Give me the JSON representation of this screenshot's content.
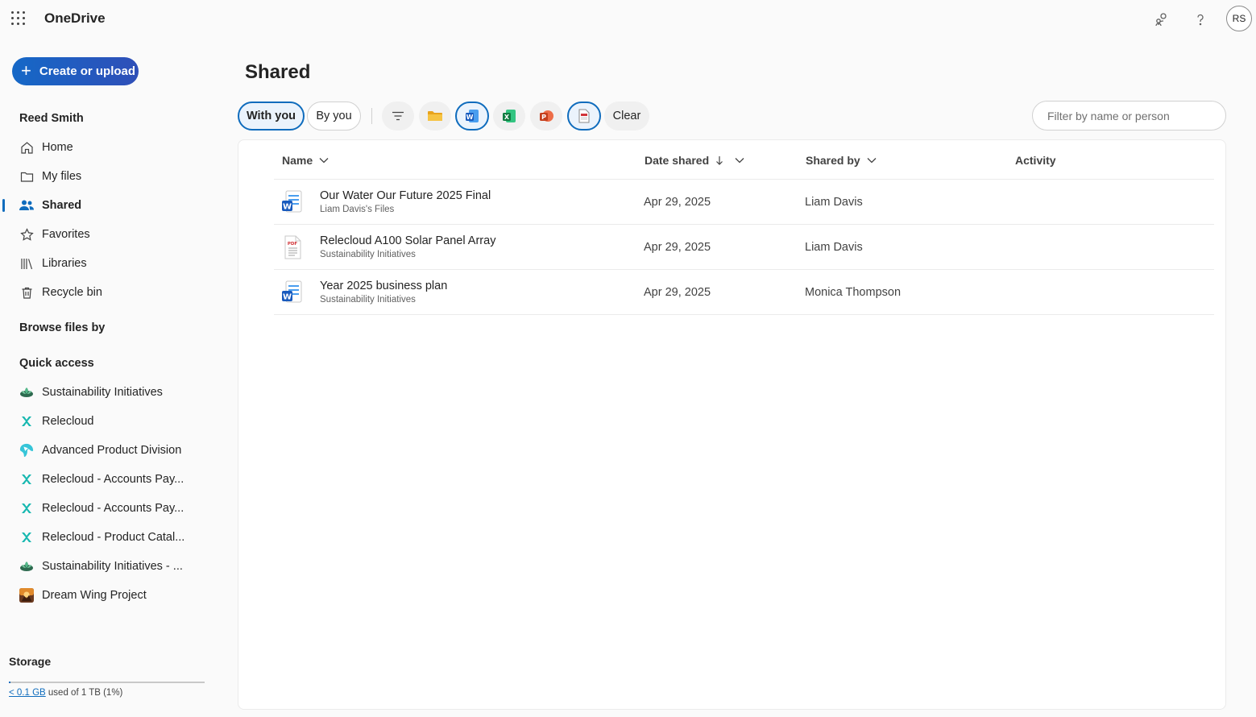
{
  "app": {
    "name": "OneDrive",
    "user_initials": "RS"
  },
  "sidebar": {
    "create_label": "Create or upload",
    "user_name": "Reed Smith",
    "nav": [
      {
        "label": "Home",
        "icon": "home-icon"
      },
      {
        "label": "My files",
        "icon": "folder-icon"
      },
      {
        "label": "Shared",
        "icon": "people-icon",
        "active": true
      },
      {
        "label": "Favorites",
        "icon": "star-icon"
      },
      {
        "label": "Libraries",
        "icon": "library-icon"
      },
      {
        "label": "Recycle bin",
        "icon": "trash-icon"
      }
    ],
    "browse_title": "Browse files by",
    "quick_access_title": "Quick access",
    "quick_access": [
      {
        "label": "Sustainability Initiatives",
        "icon": "sustainability-site-icon"
      },
      {
        "label": "Relecloud",
        "icon": "relecloud-site-icon"
      },
      {
        "label": "Advanced Product Division",
        "icon": "product-division-site-icon"
      },
      {
        "label": "Relecloud - Accounts Pay...",
        "icon": "relecloud-site-icon"
      },
      {
        "label": "Relecloud - Accounts Pay...",
        "icon": "relecloud-site-icon"
      },
      {
        "label": "Relecloud - Product Catal...",
        "icon": "relecloud-site-icon"
      },
      {
        "label": "Sustainability Initiatives - ...",
        "icon": "sustainability-site-icon"
      },
      {
        "label": "Dream Wing Project",
        "icon": "dream-wing-site-icon"
      }
    ],
    "storage": {
      "title": "Storage",
      "used_link": "< 0.1 GB",
      "used_text": " used of 1 TB (1%)",
      "percent_used": 1
    }
  },
  "main": {
    "title": "Shared",
    "tabs": [
      {
        "label": "With you",
        "selected": true
      },
      {
        "label": "By you",
        "selected": false
      }
    ],
    "filters": [
      "filter-icon",
      "folder-type-icon",
      "word-type-icon",
      "excel-type-icon",
      "powerpoint-type-icon",
      "pdf-type-icon"
    ],
    "clear_label": "Clear",
    "search_placeholder": "Filter by name or person",
    "columns": {
      "name": "Name",
      "date": "Date shared",
      "shared_by": "Shared by",
      "activity": "Activity"
    },
    "rows": [
      {
        "name": "Our Water Our Future 2025 Final",
        "location": "Liam Davis's Files",
        "date": "Apr 29, 2025",
        "shared_by": "Liam Davis",
        "type": "word"
      },
      {
        "name": "Relecloud A100 Solar Panel Array",
        "location": "Sustainability Initiatives",
        "date": "Apr 29, 2025",
        "shared_by": "Liam Davis",
        "type": "pdf"
      },
      {
        "name": "Year 2025 business plan",
        "location": "Sustainability Initiatives",
        "date": "Apr 29, 2025",
        "shared_by": "Monica Thompson",
        "type": "word"
      }
    ]
  },
  "colors": {
    "accent": "#0f6cbd",
    "word": "#185abd",
    "excel": "#107c41",
    "powerpoint": "#c43e1c",
    "pdf": "#d13438",
    "folder": "#f4b400"
  }
}
